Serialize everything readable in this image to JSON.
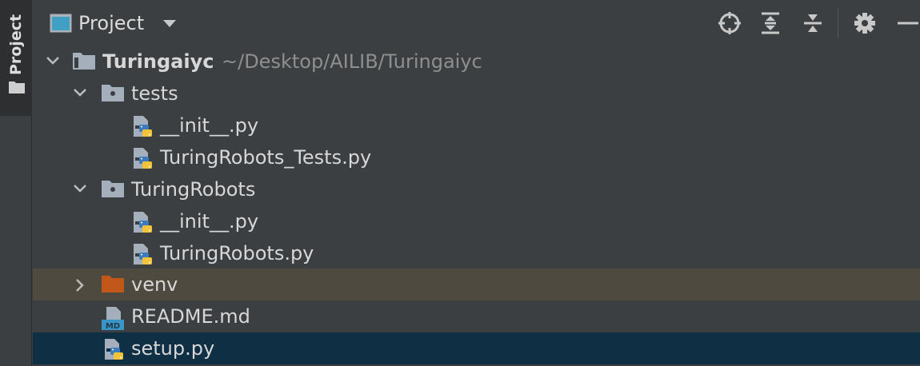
{
  "stripe": {
    "label": "Project"
  },
  "header": {
    "title": "Project"
  },
  "tree": {
    "root": {
      "name": "Turingaiyc",
      "path": "~/Desktop/AILIB/Turingaiyc"
    },
    "tests": {
      "name": "tests",
      "files": [
        "__init__.py",
        "TuringRobots_Tests.py"
      ]
    },
    "turing_robots": {
      "name": "TuringRobots",
      "files": [
        "__init__.py",
        "TuringRobots.py"
      ]
    },
    "venv": {
      "name": "venv"
    },
    "readme": {
      "name": "README.md"
    },
    "setup": {
      "name": "setup.py"
    }
  },
  "colors": {
    "background": "#3c3f41",
    "venv_highlight": "#4e4a3f",
    "selection": "#0e2f44",
    "excluded_folder": "#c2571a"
  }
}
